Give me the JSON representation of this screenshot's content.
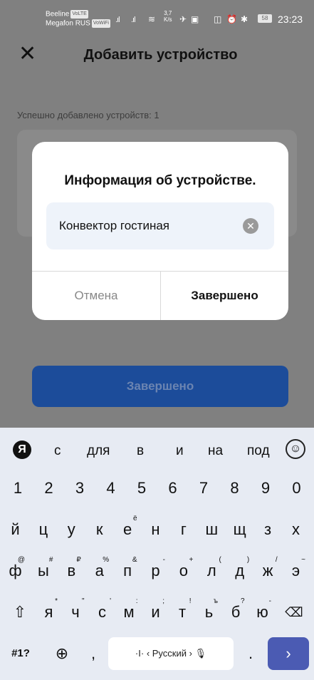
{
  "status_bar": {
    "carrier1": "Beeline",
    "carrier1_tag": "VoLTE",
    "carrier2": "Megafon RUS",
    "carrier2_tag": "VoWiFi",
    "net_speed_value": "3,7",
    "net_speed_unit": "K/s",
    "battery": "58",
    "time": "23:23"
  },
  "header": {
    "title": "Добавить устройство"
  },
  "main": {
    "added_count_text": "Успешно добавлено устройств: 1",
    "finish_button_label": "Завершено"
  },
  "dialog": {
    "title": "Информация об устройстве.",
    "name_value": "Конвектор гостиная",
    "cancel_label": "Отмена",
    "done_label": "Завершено"
  },
  "keyboard": {
    "yandex_label": "Я",
    "suggestions": [
      "с",
      "для",
      "в",
      "и",
      "на",
      "под"
    ],
    "digits": [
      "1",
      "2",
      "3",
      "4",
      "5",
      "6",
      "7",
      "8",
      "9",
      "0"
    ],
    "row1": [
      "й",
      "ц",
      "у",
      "к",
      "е",
      "н",
      "г",
      "ш",
      "щ",
      "з",
      "х"
    ],
    "row1_sup": [
      "",
      "",
      "",
      "",
      "ё",
      "",
      "",
      "",
      "",
      "",
      ""
    ],
    "row2": [
      "ф",
      "ы",
      "в",
      "а",
      "п",
      "р",
      "о",
      "л",
      "д",
      "ж",
      "э"
    ],
    "row2_sup": [
      "@",
      "#",
      "₽",
      "%",
      "&",
      "-",
      "+",
      "(",
      ")",
      "/",
      "~"
    ],
    "row3": [
      "я",
      "ч",
      "с",
      "м",
      "и",
      "т",
      "ь",
      "б",
      "ю"
    ],
    "row3_sup": [
      "*",
      "\"",
      "'",
      ":",
      ";",
      "!",
      "ъ",
      "?",
      "-"
    ],
    "symbols_label": "#1?",
    "comma_label": ",",
    "space_label": "‹ Русский ›",
    "period_label": "."
  }
}
